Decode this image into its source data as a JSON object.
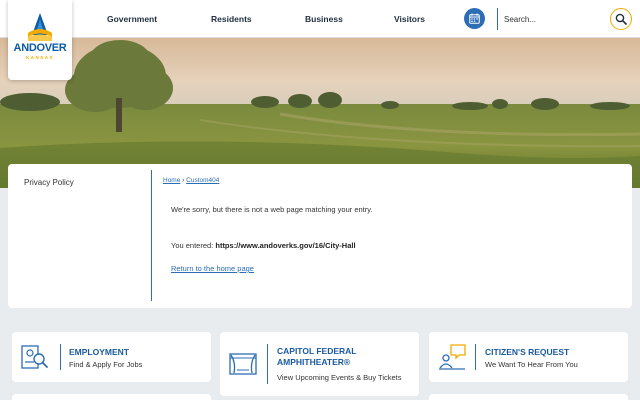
{
  "logo": {
    "name": "ANDOVER",
    "sub": "KANSAS"
  },
  "nav": [
    {
      "label": "Government"
    },
    {
      "label": "Residents"
    },
    {
      "label": "Business"
    },
    {
      "label": "Visitors"
    }
  ],
  "header": {
    "calendar_icon": "calendar-icon",
    "search_placeholder": "Search...",
    "search_icon": "magnifier-icon"
  },
  "sidebar": {
    "link": "Privacy Policy"
  },
  "breadcrumb": {
    "home": "Home",
    "separator": "›",
    "current": "Custom404"
  },
  "content": {
    "message": "We're sorry, but there is not a web page matching your entry.",
    "entered_label": "You entered:",
    "entered_url": "https://www.andoverks.gov/16/City-Hall",
    "return_link": "Return to the home page"
  },
  "tiles": [
    {
      "title": "EMPLOYMENT",
      "subtitle": "Find & Apply For Jobs",
      "icon": "job-search-icon"
    },
    {
      "title": "CAPITOL FEDERAL AMPHITHEATER®",
      "subtitle": "View Upcoming Events & Buy Tickets",
      "icon": "theater-stage-icon"
    },
    {
      "title": "CITIZEN'S REQUEST",
      "subtitle": "We Want To Hear From You",
      "icon": "chat-request-icon"
    }
  ],
  "colors": {
    "brand_blue": "#2d6db5",
    "accent_gold": "#f2a900",
    "title_blue": "#1b5aa0"
  }
}
